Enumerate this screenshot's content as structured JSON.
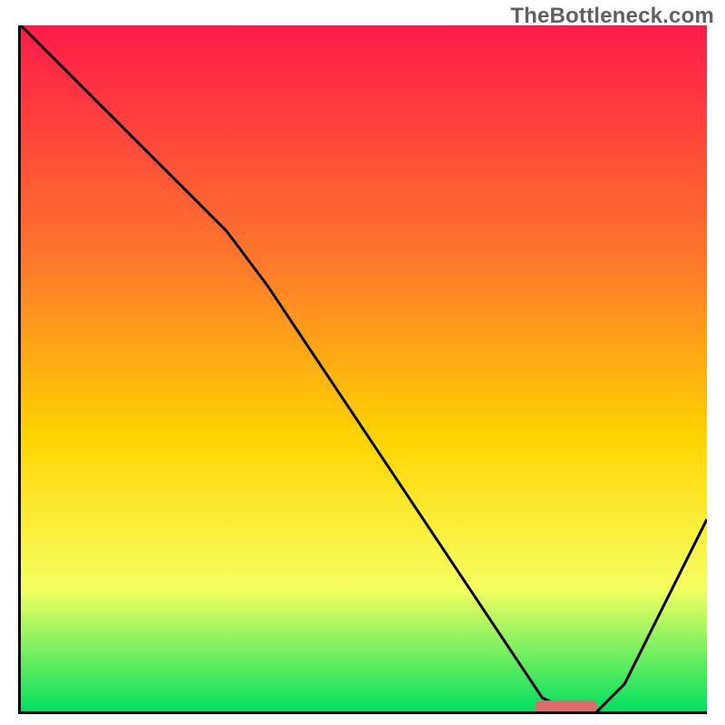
{
  "watermark": "TheBottleneck.com",
  "colors": {
    "gradient_top": "#ff1a4a",
    "gradient_mid1": "#ff7a2a",
    "gradient_mid2": "#ffd400",
    "gradient_mid3": "#f6ff60",
    "gradient_bottom": "#00e060",
    "curve": "#000000",
    "marker": "#e06a6a"
  },
  "chart_data": {
    "type": "line",
    "title": "",
    "xlabel": "",
    "ylabel": "",
    "xlim": [
      0,
      100
    ],
    "ylim": [
      0,
      100
    ],
    "grid": false,
    "annotations": [
      "TheBottleneck.com"
    ],
    "series": [
      {
        "name": "bottleneck-curve",
        "x": [
          0,
          6,
          12,
          18,
          24,
          30,
          36,
          42,
          48,
          54,
          60,
          66,
          72,
          76,
          80,
          84,
          88,
          92,
          96,
          100
        ],
        "y": [
          100,
          94,
          88,
          82,
          76,
          70,
          62,
          53,
          44,
          35,
          26,
          17,
          8,
          2,
          0,
          0,
          4,
          12,
          20,
          28
        ]
      }
    ],
    "marker": {
      "name": "optimal-range",
      "x_start": 75,
      "x_end": 84,
      "y": 0
    }
  }
}
